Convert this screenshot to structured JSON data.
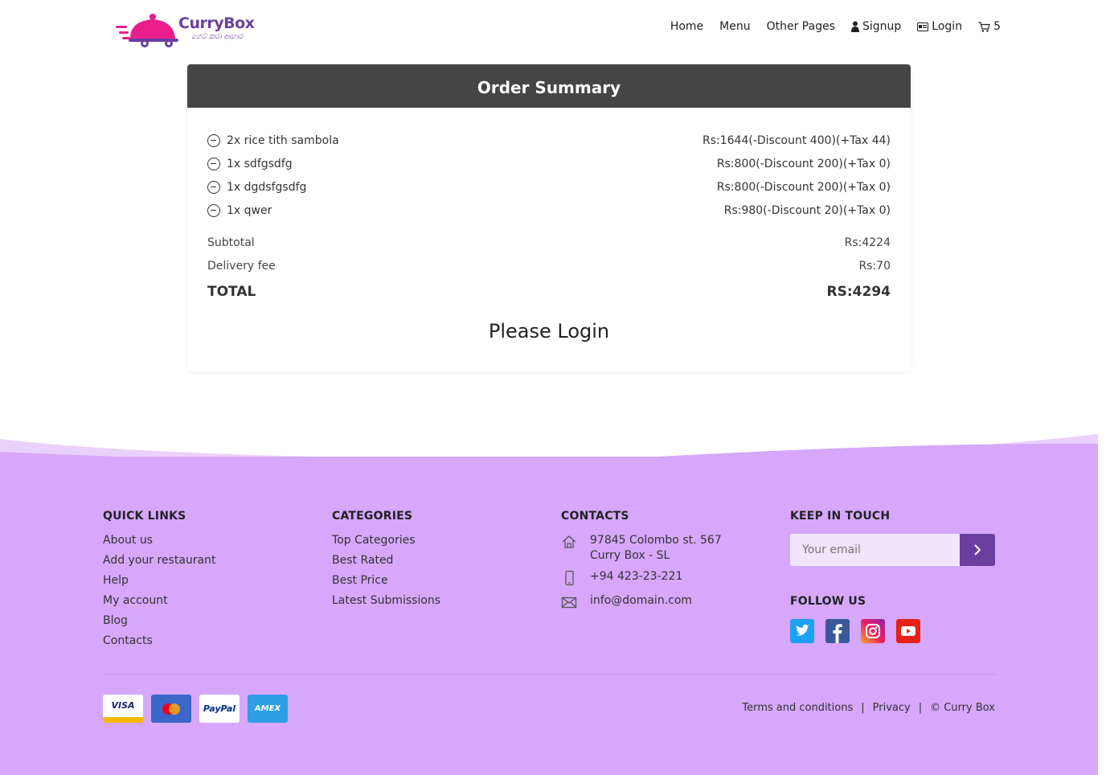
{
  "brand": {
    "name": "CurryBox",
    "tagline": "ගෙට් කරා ආහාර",
    "color": "#6b3fa0",
    "accent": "#e91e8c"
  },
  "nav": {
    "home": "Home",
    "menu": "Menu",
    "other_pages": "Other Pages",
    "signup": "Signup",
    "login": "Login",
    "cart_count": "5"
  },
  "order": {
    "title": "Order Summary",
    "items": [
      {
        "name": "2x rice tith sambola",
        "price": "Rs:1644(-Discount 400)(+Tax 44)"
      },
      {
        "name": "1x sdfgsdfg",
        "price": "Rs:800(-Discount 200)(+Tax 0)"
      },
      {
        "name": "1x dgdsfgsdfg",
        "price": "Rs:800(-Discount 200)(+Tax 0)"
      },
      {
        "name": "1x qwer",
        "price": "Rs:980(-Discount 20)(+Tax 0)"
      }
    ],
    "subtotal_label": "Subtotal",
    "subtotal_value": "Rs:4224",
    "delivery_label": "Delivery fee",
    "delivery_value": "Rs:70",
    "total_label": "TOTAL",
    "total_value": "RS:4294",
    "login_prompt": "Please Login"
  },
  "footer": {
    "quick_links": {
      "title": "QUICK LINKS",
      "items": [
        "About us",
        "Add your restaurant",
        "Help",
        "My account",
        "Blog",
        "Contacts"
      ]
    },
    "categories": {
      "title": "CATEGORIES",
      "items": [
        "Top Categories",
        "Best Rated",
        "Best Price",
        "Latest Submissions"
      ]
    },
    "contacts": {
      "title": "CONTACTS",
      "address_line1": "97845 Colombo st. 567",
      "address_line2": "Curry Box - SL",
      "phone": "+94 423-23-221",
      "email": "info@domain.com"
    },
    "keep_in_touch": {
      "title": "KEEP IN TOUCH",
      "email_placeholder": "Your email"
    },
    "follow_us": {
      "title": "FOLLOW US"
    },
    "payment_cards": [
      "VISA",
      "PayPal",
      "AMEX"
    ],
    "legal": {
      "terms": "Terms and conditions",
      "privacy": "Privacy",
      "copyright": "© Curry Box"
    },
    "bg_color": "#d6a7fb"
  }
}
